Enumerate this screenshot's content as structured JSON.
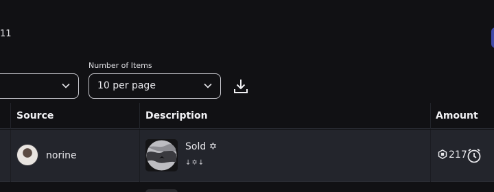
{
  "header": {
    "count_text": "11"
  },
  "filters": {
    "left_select_value": "",
    "items_label": "Number of Items",
    "items_value": "10 per page"
  },
  "table": {
    "columns": [
      "Source",
      "Description",
      "Amount"
    ],
    "rows": [
      {
        "source": "norine",
        "description_title": "Sold ✡",
        "description_sub": "↓✡↓",
        "amount": "217"
      }
    ]
  },
  "icons": {
    "download": "download-icon",
    "chevron": "chevron-down-icon",
    "currency": "robux-icon",
    "pending": "clock-icon"
  },
  "colors": {
    "background": "#111114",
    "row": "#23252c",
    "accent": "#3f4aa8"
  }
}
